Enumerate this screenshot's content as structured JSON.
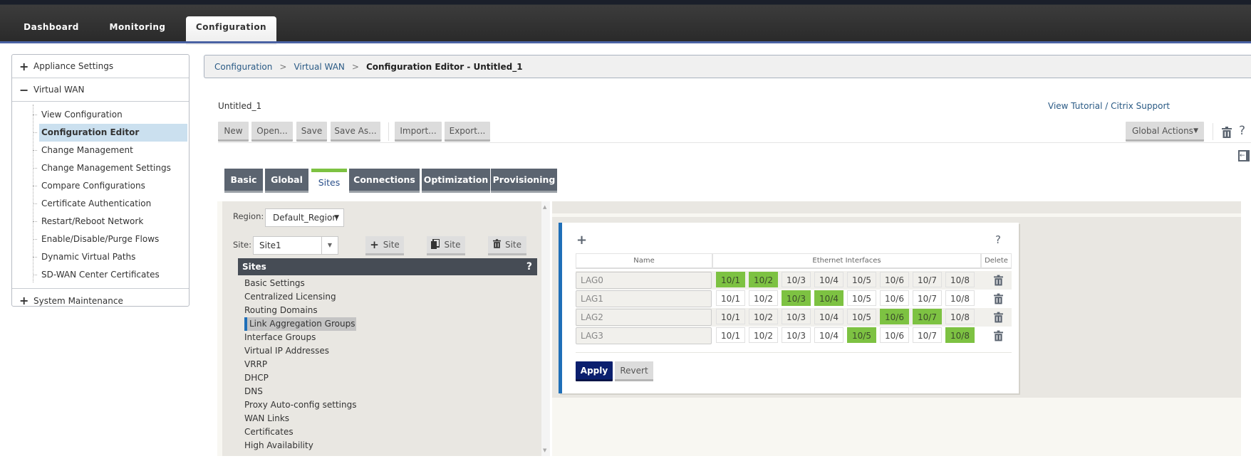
{
  "nav": {
    "tabs": [
      {
        "label": "Dashboard",
        "active": false
      },
      {
        "label": "Monitoring",
        "active": false
      },
      {
        "label": "Configuration",
        "active": true
      }
    ]
  },
  "sidebar": {
    "sections": [
      {
        "label": "Appliance Settings",
        "expanded": false,
        "toggle": "+"
      },
      {
        "label": "Virtual WAN",
        "expanded": true,
        "toggle": "−"
      },
      {
        "label": "System Maintenance",
        "expanded": false,
        "toggle": "+"
      }
    ],
    "virtual_wan_items": [
      {
        "label": "View Configuration"
      },
      {
        "label": "Configuration Editor",
        "active": true
      },
      {
        "label": "Change Management"
      },
      {
        "label": "Change Management Settings"
      },
      {
        "label": "Compare Configurations"
      },
      {
        "label": "Certificate Authentication"
      },
      {
        "label": "Restart/Reboot Network"
      },
      {
        "label": "Enable/Disable/Purge Flows"
      },
      {
        "label": "Dynamic Virtual Paths"
      },
      {
        "label": "SD-WAN Center Certificates"
      }
    ]
  },
  "breadcrumb": {
    "items": [
      "Configuration",
      "Virtual WAN"
    ],
    "separator": ">",
    "current": "Configuration Editor - Untitled_1"
  },
  "editor": {
    "file_name": "Untitled_1",
    "support_link": "View Tutorial / Citrix Support",
    "toolbar": {
      "new": "New",
      "open": "Open...",
      "save": "Save",
      "save_as": "Save As...",
      "import": "Import...",
      "export": "Export...",
      "global_actions": "Global Actions",
      "help": "?"
    },
    "tabs": [
      {
        "label": "Basic"
      },
      {
        "label": "Global"
      },
      {
        "label": "Sites",
        "active": true
      },
      {
        "label": "Connections"
      },
      {
        "label": "Optimization"
      },
      {
        "label": "Provisioning"
      }
    ]
  },
  "sites_panel": {
    "region_label": "Region:",
    "region_value": "Default_Region",
    "site_label": "Site:",
    "site_value": "Site1",
    "add_site": "Site",
    "clone_site": "Site",
    "delete_site": "Site",
    "header": "Sites",
    "help": "?",
    "items": [
      "Basic Settings",
      "Centralized Licensing",
      "Routing Domains",
      "Link Aggregation Groups",
      "Interface Groups",
      "Virtual IP Addresses",
      "VRRP",
      "DHCP",
      "DNS",
      "Proxy Auto-config settings",
      "WAN Links",
      "Certificates",
      "High Availability"
    ],
    "active_item": "Link Aggregation Groups"
  },
  "lag": {
    "add": "+",
    "help": "?",
    "headers": {
      "name": "Name",
      "interfaces": "Ethernet Interfaces",
      "delete": "Delete"
    },
    "interfaces": [
      "10/1",
      "10/2",
      "10/3",
      "10/4",
      "10/5",
      "10/6",
      "10/7",
      "10/8"
    ],
    "rows": [
      {
        "name": "LAG0",
        "selected": [
          "10/1",
          "10/2"
        ]
      },
      {
        "name": "LAG1",
        "selected": [
          "10/3",
          "10/4"
        ]
      },
      {
        "name": "LAG2",
        "selected": [
          "10/6",
          "10/7"
        ]
      },
      {
        "name": "LAG3",
        "selected": [
          "10/5",
          "10/8"
        ]
      }
    ],
    "apply": "Apply",
    "revert": "Revert",
    "selected_color": "#7dc242"
  }
}
